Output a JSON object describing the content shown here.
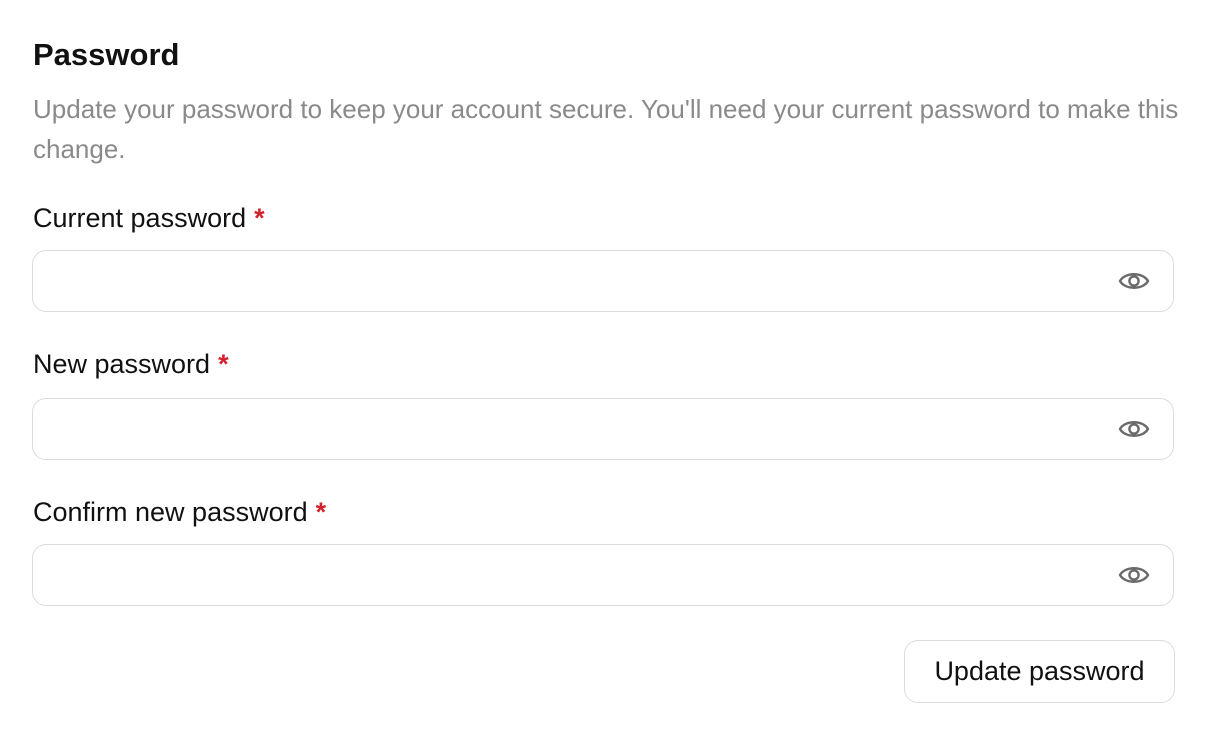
{
  "section": {
    "title": "Password",
    "description": "Update your password to keep your account secure. You'll need your current password to make this change."
  },
  "fields": [
    {
      "label": "Current password",
      "required_mark": "*",
      "value": "",
      "placeholder": "",
      "toggle_icon": "eye-icon"
    },
    {
      "label": "New password",
      "required_mark": "*",
      "value": "",
      "placeholder": "",
      "toggle_icon": "eye-icon"
    },
    {
      "label": "Confirm new password",
      "required_mark": "*",
      "value": "",
      "placeholder": "",
      "toggle_icon": "eye-icon"
    }
  ],
  "actions": {
    "submit_label": "Update password"
  },
  "colors": {
    "text": "#111111",
    "muted": "#8a8a8a",
    "required": "#d3212c",
    "border": "#dcdcdc",
    "icon": "#6b6b6b"
  }
}
